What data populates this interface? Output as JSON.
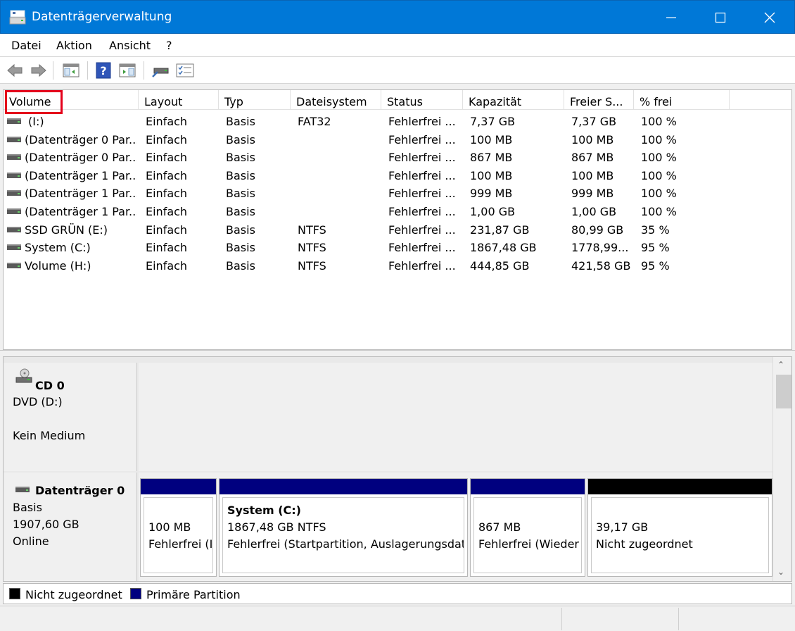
{
  "window": {
    "title": "Datenträgerverwaltung"
  },
  "menu": {
    "items": [
      "Datei",
      "Aktion",
      "Ansicht",
      "?"
    ]
  },
  "toolbar": {
    "icons": [
      "back-arrow-icon",
      "forward-arrow-icon",
      "console-tree-icon",
      "help-icon",
      "properties-icon",
      "connect-disk-icon",
      "checklist-icon"
    ]
  },
  "volumes": {
    "columns": [
      "Volume",
      "Layout",
      "Typ",
      "Dateisystem",
      "Status",
      "Kapazität",
      "Freier S...",
      "% frei"
    ],
    "rows": [
      [
        "(I:)",
        "Einfach",
        "Basis",
        "FAT32",
        "Fehlerfrei ...",
        "7,37 GB",
        "7,37 GB",
        "100 %"
      ],
      [
        "(Datenträger 0 Par...",
        "Einfach",
        "Basis",
        "",
        "Fehlerfrei ...",
        "100 MB",
        "100 MB",
        "100 %"
      ],
      [
        "(Datenträger 0 Par...",
        "Einfach",
        "Basis",
        "",
        "Fehlerfrei ...",
        "867 MB",
        "867 MB",
        "100 %"
      ],
      [
        "(Datenträger 1 Par...",
        "Einfach",
        "Basis",
        "",
        "Fehlerfrei ...",
        "100 MB",
        "100 MB",
        "100 %"
      ],
      [
        "(Datenträger 1 Par...",
        "Einfach",
        "Basis",
        "",
        "Fehlerfrei ...",
        "999 MB",
        "999 MB",
        "100 %"
      ],
      [
        "(Datenträger 1 Par...",
        "Einfach",
        "Basis",
        "",
        "Fehlerfrei ...",
        "1,00 GB",
        "1,00 GB",
        "100 %"
      ],
      [
        "SSD GRÜN (E:)",
        "Einfach",
        "Basis",
        "NTFS",
        "Fehlerfrei ...",
        "231,87 GB",
        "80,99 GB",
        "35 %"
      ],
      [
        "System (C:)",
        "Einfach",
        "Basis",
        "NTFS",
        "Fehlerfrei ...",
        "1867,48 GB",
        "1778,99...",
        "95 %"
      ],
      [
        "Volume (H:)",
        "Einfach",
        "Basis",
        "NTFS",
        "Fehlerfrei ...",
        "444,85 GB",
        "421,58 GB",
        "95 %"
      ]
    ]
  },
  "disks": {
    "cd0": {
      "name": "CD 0",
      "drive": "DVD (D:)",
      "status": "Kein Medium"
    },
    "disk0": {
      "name": "Datenträger 0",
      "type": "Basis",
      "size": "1907,60 GB",
      "state": "Online"
    }
  },
  "partitions": [
    {
      "title": "",
      "line1": "100 MB",
      "line2": "Fehlerfrei (I",
      "color": "#00007f"
    },
    {
      "title": "System  (C:)",
      "line1": "1867,48 GB NTFS",
      "line2": "Fehlerfrei (Startpartition, Auslagerungsdat",
      "color": "#00007f"
    },
    {
      "title": "",
      "line1": "867 MB",
      "line2": "Fehlerfrei (Wieder",
      "color": "#00007f"
    },
    {
      "title": "",
      "line1": "39,17 GB",
      "line2": "Nicht zugeordnet",
      "color": "#000000"
    }
  ],
  "legend": [
    {
      "label": "Nicht zugeordnet",
      "color": "#000000"
    },
    {
      "label": "Primäre Partition",
      "color": "#00007f"
    }
  ]
}
